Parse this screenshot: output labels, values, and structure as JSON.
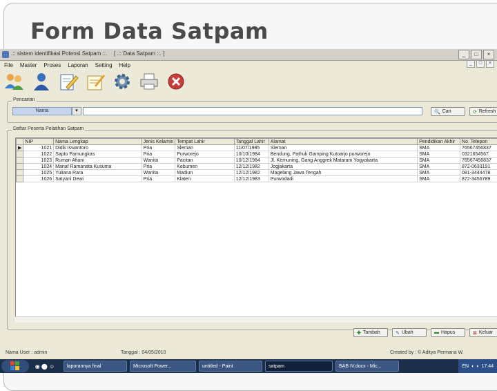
{
  "slide": {
    "title": "Form Data Satpam"
  },
  "window": {
    "app_title": ".:: sistem identifikasi Potensi Satpam ::.",
    "inner_title": "[ .:: Data Satpam ::. ]",
    "minimize": "_",
    "maximize": "□",
    "close": "×"
  },
  "menu": {
    "items": [
      "File",
      "Master",
      "Proses",
      "Laporan",
      "Setting",
      "Help"
    ]
  },
  "toolbar": {
    "icons": [
      "users-icon",
      "user-icon",
      "edit-icon",
      "notepad-icon",
      "gear-icon",
      "printer-icon",
      "exit-icon"
    ]
  },
  "search": {
    "group_label": "Pencarian",
    "field_value": "Nama",
    "query": "",
    "search_label": "Cari",
    "refresh_label": "Refresh"
  },
  "table": {
    "group_label": "Daftar Peserta Pelatihan Satpam",
    "columns": [
      "NIP",
      "Nama Lengkap",
      "Jenis Kelamin",
      "Tempat Lahir",
      "Tanggal Lahir",
      "Alamat",
      "Pendidikan Akhir",
      "No. Telepon"
    ],
    "rows": [
      [
        "1021",
        "Didik Iswantoro",
        "Pria",
        "Sleman",
        "11/07/1985",
        "Sleman",
        "SMA",
        "76567456837"
      ],
      [
        "1022",
        "Sapto Pamungkas",
        "Pria",
        "Purworejo",
        "10/10/1984",
        "Bendung, Pathuk Gamping Kutoarjo purworejo",
        "SMA",
        "0321654567"
      ],
      [
        "1023",
        "Rumari Afiani",
        "Wanita",
        "Pacitan",
        "10/12/1984",
        "Jl. Kemuning, Gang Anggrek Mataram Yogyakarta",
        "SMA",
        "76567456837"
      ],
      [
        "1024",
        "Manaf Ramanata Kusuma",
        "Pria",
        "Kebumen",
        "12/12/1982",
        "Jogjakarta",
        "SMA",
        "872-0633191"
      ],
      [
        "1025",
        "Yuliana Rara",
        "Wanita",
        "Madiun",
        "12/12/1982",
        "Magelang Jawa Tengah",
        "SMA",
        "081-3444478"
      ],
      [
        "1026",
        "Satyani Dewi",
        "Pria",
        "Klaten",
        "12/12/1983",
        "Purwodadi",
        "SMA",
        "872-3456789"
      ]
    ]
  },
  "footer": {
    "tambah": "Tambah",
    "ubah": "Ubah",
    "hapus": "Hapus",
    "keluar": "Keluar"
  },
  "status": {
    "user": "Nama User : admin",
    "date": "Tanggal : 04/05/2010",
    "credit": "Created by : © Aditya Permana W."
  },
  "taskbar": {
    "tasks": [
      "laporannya final",
      "Microsoft Power...",
      "untitled - Paint",
      "satpam",
      "BAB IV.docx - Mic..."
    ],
    "tray_lang": "EN",
    "clock": "17:44"
  }
}
